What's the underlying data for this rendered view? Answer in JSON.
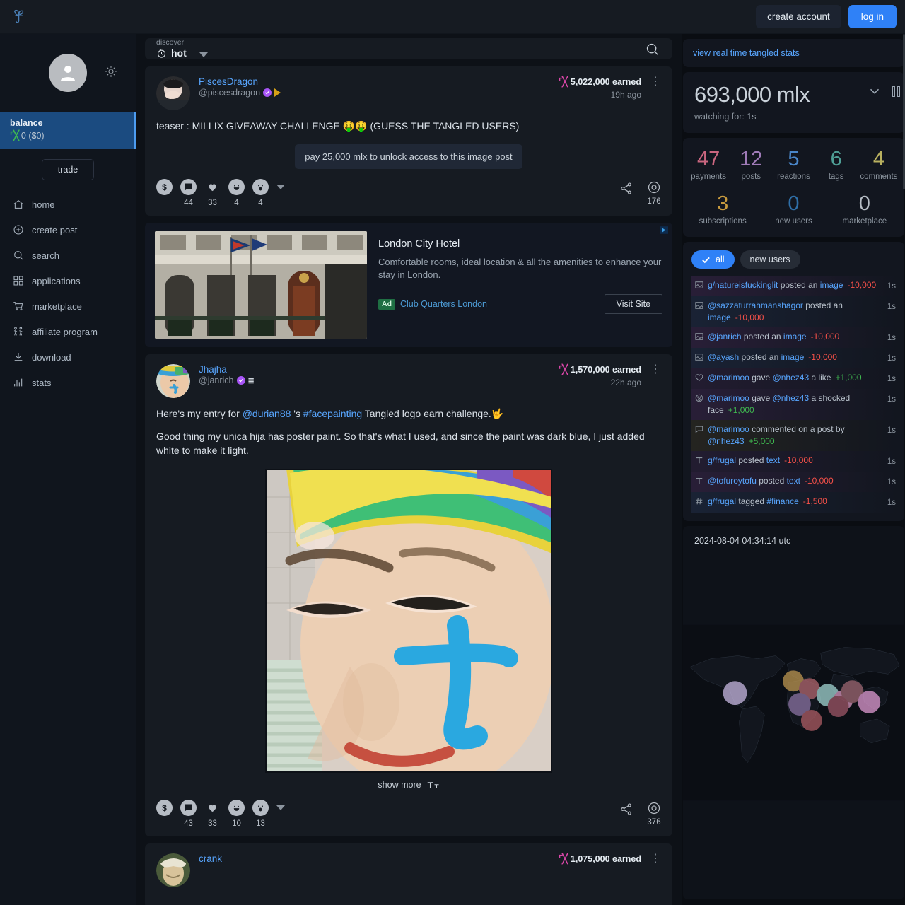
{
  "topbar": {
    "logo_name": "tangled-logo",
    "create_account": "create account",
    "log_in": "log in"
  },
  "sidebar": {
    "balance_label": "balance",
    "balance_currency_symbol": "M",
    "balance_value": "0 ($0)",
    "trade_label": "trade",
    "items": [
      {
        "label": "home",
        "icon": "home-icon"
      },
      {
        "label": "create post",
        "icon": "plus-circle-icon"
      },
      {
        "label": "search",
        "icon": "search-icon"
      },
      {
        "label": "applications",
        "icon": "grid-icon"
      },
      {
        "label": "marketplace",
        "icon": "cart-icon"
      },
      {
        "label": "affiliate program",
        "icon": "people-icon"
      },
      {
        "label": "download",
        "icon": "download-icon"
      },
      {
        "label": "stats",
        "icon": "bar-chart-icon"
      }
    ]
  },
  "feed": {
    "discover_label": "discover",
    "discover_value": "hot",
    "search_icon": "search-icon",
    "posts": [
      {
        "username": "PiscesDragon",
        "handle": "@piscesdragon",
        "earned": "5,022,000 earned",
        "ago": "19h ago",
        "text": "teaser : MILLIX GIVEAWAY CHALLENGE 🤑🤑 (GUESS THE TANGLED USERS)",
        "paywall": "pay 25,000 mlx to unlock access to this image post",
        "reactions": [
          {
            "icon": "dollar-icon",
            "count": ""
          },
          {
            "icon": "comment-icon",
            "count": "44"
          },
          {
            "icon": "heart-icon",
            "count": "33"
          },
          {
            "icon": "laugh-icon",
            "count": "4"
          },
          {
            "icon": "shocked-icon",
            "count": "4"
          }
        ],
        "views": "176"
      },
      {
        "username": "Jhajha",
        "handle": "@janrich",
        "earned": "1,570,000 earned",
        "ago": "22h ago",
        "text_line1_pre": "Here's my entry for ",
        "text_mention": "@durian88",
        "text_line1_mid": " 's ",
        "text_tag": "#facepainting",
        "text_line1_post": " Tangled logo earn challenge.🤟",
        "text_line2": "Good thing my unica hija has poster paint. So that's what I used, and since the paint was dark blue, I just added white to make it light.",
        "show_more": "show more",
        "reactions": [
          {
            "icon": "dollar-icon",
            "count": ""
          },
          {
            "icon": "comment-icon",
            "count": "43"
          },
          {
            "icon": "heart-icon",
            "count": "33"
          },
          {
            "icon": "laugh-icon",
            "count": "10"
          },
          {
            "icon": "shocked-icon",
            "count": "13"
          }
        ],
        "views": "376"
      },
      {
        "username": "crank",
        "earned": "1,075,000 earned"
      }
    ]
  },
  "ad": {
    "title": "London City Hotel",
    "description": "Comfortable rooms, ideal location & all the amenities to enhance your stay in London.",
    "chip": "Ad",
    "source": "Club Quarters London",
    "cta": "Visit Site",
    "adchoices_icon": "adchoices-icon"
  },
  "right": {
    "stats_link": "view real time tangled stats",
    "mlx_total": "693,000 mlx",
    "watching": "watching for: 1s",
    "chevron_icon": "chevron-down-icon",
    "pause_icon": "pause-icon",
    "stats_row1": [
      {
        "num": "47",
        "label": "payments",
        "color": "#c9667f"
      },
      {
        "num": "12",
        "label": "posts",
        "color": "#a07bb8"
      },
      {
        "num": "5",
        "label": "reactions",
        "color": "#4a86c8"
      },
      {
        "num": "6",
        "label": "tags",
        "color": "#4f9f96"
      },
      {
        "num": "4",
        "label": "comments",
        "color": "#b8b05f"
      }
    ],
    "stats_row2": [
      {
        "num": "3",
        "label": "subscriptions",
        "color": "#c79a3e"
      },
      {
        "num": "0",
        "label": "new users",
        "color": "#2f6fa8"
      },
      {
        "num": "0",
        "label": "marketplace",
        "color": "#b6bdc5"
      }
    ],
    "filters": [
      {
        "label": "all",
        "active": true
      },
      {
        "label": "new users",
        "active": false
      }
    ],
    "activity": [
      {
        "glyph": "image-icon",
        "subject": "g/natureisfuckinglit",
        "verb": " posted an ",
        "object": "image",
        "amount": "-10,000",
        "sign": "neg",
        "time": "1s",
        "hl": "hl-a"
      },
      {
        "glyph": "image-icon",
        "subject": "@sazzaturrahmanshagor",
        "verb": " posted an ",
        "object": "image",
        "amount": "-10,000",
        "sign": "neg",
        "time": "1s",
        "hl": "hl-b"
      },
      {
        "glyph": "image-icon",
        "subject": "@janrich",
        "verb": " posted an ",
        "object": "image",
        "amount": "-10,000",
        "sign": "neg",
        "time": "1s",
        "hl": "hl-a"
      },
      {
        "glyph": "image-icon",
        "subject": "@ayash",
        "verb": " posted an ",
        "object": "image",
        "amount": "-10,000",
        "sign": "neg",
        "time": "1s",
        "hl": "hl-b"
      },
      {
        "glyph": "heart-outline-icon",
        "subject": "@marimoo",
        "verb": " gave ",
        "object": "@nhez43",
        "tail": " a like",
        "amount": "+1,000",
        "sign": "pos",
        "time": "1s",
        "hl": "hl-d"
      },
      {
        "glyph": "shocked-outline-icon",
        "subject": "@marimoo",
        "verb": " gave ",
        "object": "@nhez43",
        "tail": " a shocked face",
        "amount": "+1,000",
        "sign": "pos",
        "time": "1s",
        "hl": "hl-a"
      },
      {
        "glyph": "comment-outline-icon",
        "subject": "@marimoo",
        "verb": " commented on a post by ",
        "object": "@nhez43",
        "amount": "+5,000",
        "sign": "pos",
        "time": "1s",
        "hl": "hl-c"
      },
      {
        "glyph": "text-icon",
        "subject": "g/frugal",
        "verb": " posted ",
        "object": "text",
        "amount": "-10,000",
        "sign": "neg",
        "time": "1s",
        "hl": "hl-d"
      },
      {
        "glyph": "text-icon",
        "subject": "@tofuroytofu",
        "verb": " posted ",
        "object": "text",
        "amount": "-10,000",
        "sign": "neg",
        "time": "1s",
        "hl": "hl-a"
      },
      {
        "glyph": "hash-icon",
        "subject": "g/frugal",
        "verb": " tagged ",
        "object": "#finance",
        "amount": "-1,500",
        "sign": "neg",
        "time": "1s",
        "hl": "hl-b"
      }
    ],
    "map_timestamp": "2024-08-04 04:34:14 utc"
  }
}
